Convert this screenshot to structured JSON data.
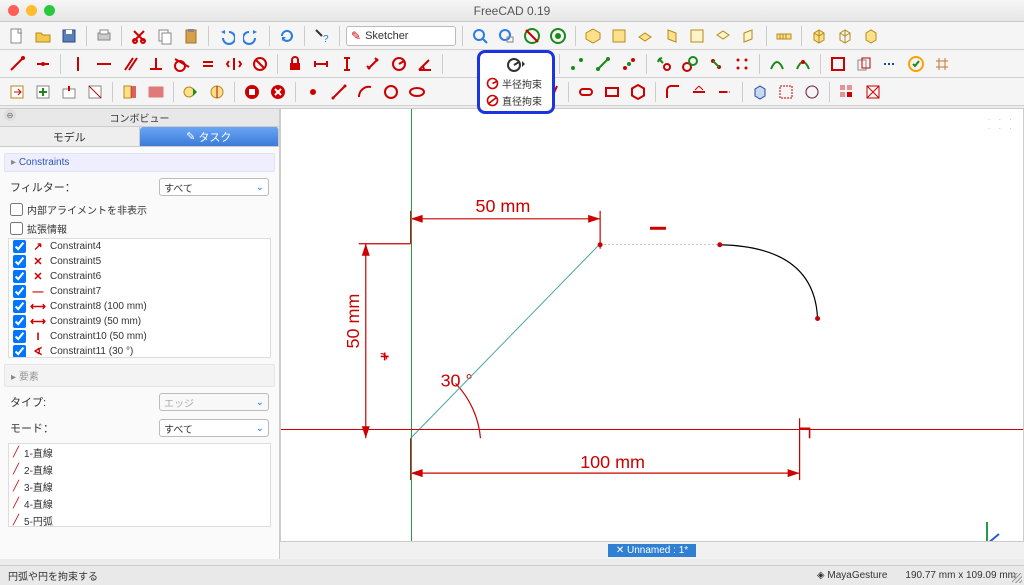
{
  "app": {
    "title": "FreeCAD 0.19"
  },
  "workbench": {
    "selected": "Sketcher"
  },
  "popup": {
    "item1": "半径拘束",
    "item2": "直径拘束"
  },
  "panel": {
    "title": "コンボビュー",
    "tab_model": "モデル",
    "tab_task": "タスク",
    "section_constraints": "Constraints",
    "filter_label": "フィルター：",
    "filter_value": "すべて",
    "hide_internal": "内部アライメントを非表示",
    "ext_info": "拡張情報",
    "constraints": [
      {
        "icon": "↗",
        "label": "Constraint4",
        "checked": true
      },
      {
        "icon": "✕",
        "label": "Constraint5",
        "checked": true
      },
      {
        "icon": "✕",
        "label": "Constraint6",
        "checked": true
      },
      {
        "icon": "—",
        "label": "Constraint7",
        "checked": true
      },
      {
        "icon": "⟷",
        "label": "Constraint8 (100 mm)",
        "checked": true
      },
      {
        "icon": "⟷",
        "label": "Constraint9 (50 mm)",
        "checked": true
      },
      {
        "icon": "I",
        "label": "Constraint10 (50 mm)",
        "checked": true
      },
      {
        "icon": "∢",
        "label": "Constraint11 (30 °)",
        "checked": true
      }
    ],
    "section_elements": "要素",
    "type_label": "タイプ:",
    "type_value": "エッジ",
    "mode_label": "モード：",
    "mode_value": "すべて",
    "elements": [
      {
        "label": "1-直線"
      },
      {
        "label": "2-直線"
      },
      {
        "label": "3-直線"
      },
      {
        "label": "4-直線"
      },
      {
        "label": "5-円弧"
      }
    ]
  },
  "sketch": {
    "dim_top": "50 mm",
    "dim_left": "50 mm",
    "dim_bottom": "100 mm",
    "angle": "30 °"
  },
  "doc_badge": "✕  Unnamed : 1*",
  "status": {
    "hint": "円弧や円を拘束する",
    "nav": "MayaGesture",
    "coords": "190.77 mm x 109.09 mm"
  }
}
